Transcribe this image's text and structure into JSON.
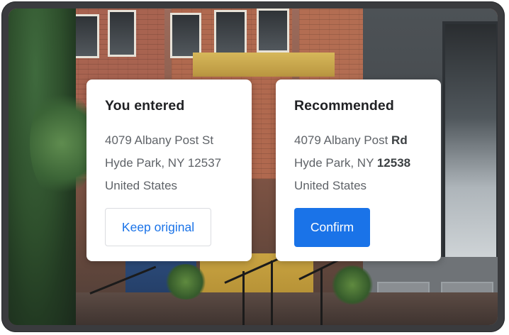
{
  "entered_card": {
    "title": "You entered",
    "street": "4079 Albany Post St",
    "city_line": "Hyde Park, NY 12537",
    "country": "United States",
    "button_label": "Keep original"
  },
  "recommended_card": {
    "title": "Recommended",
    "street_prefix": "4079 Albany Post ",
    "street_changed": "Rd",
    "city_prefix": "Hyde Park, NY ",
    "zip_changed": "12538",
    "country": "United States",
    "button_label": "Confirm"
  },
  "colors": {
    "accent": "#1a73e8",
    "title_text": "#202124",
    "body_text": "#5f6368",
    "outline": "#dadce0"
  }
}
